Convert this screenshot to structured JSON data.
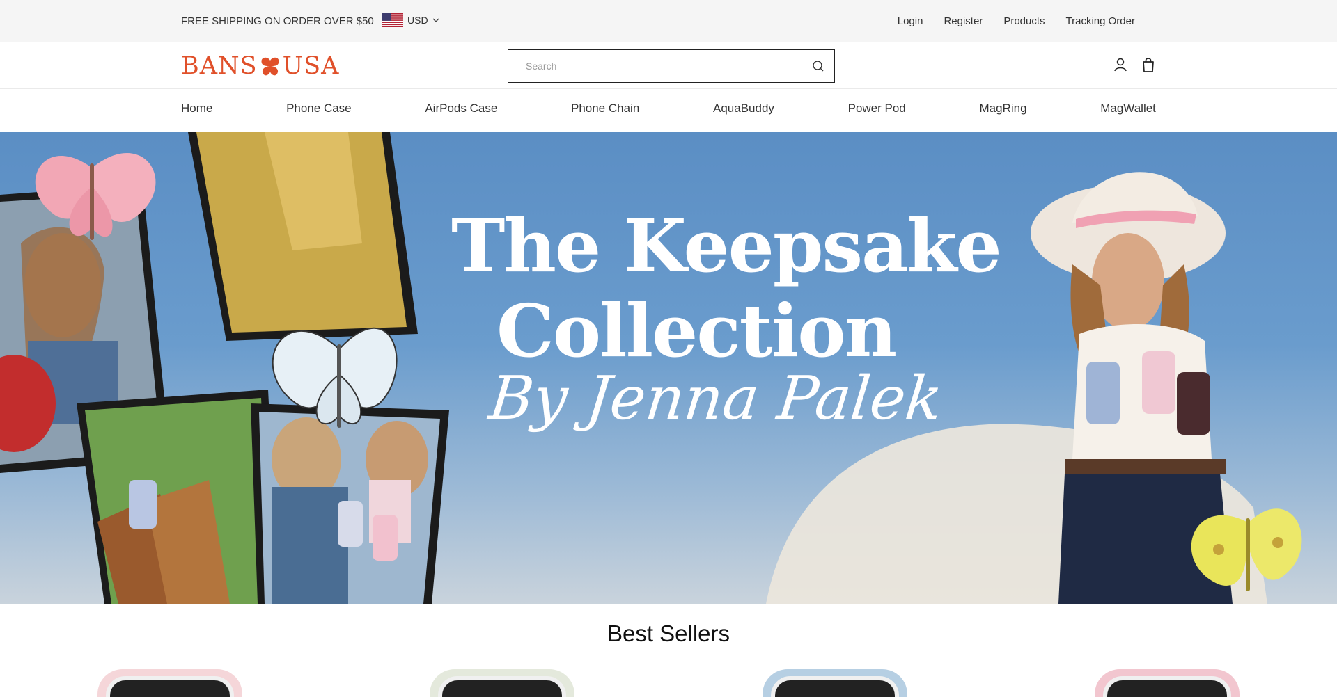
{
  "topbar": {
    "shipping_text": "FREE SHIPPING ON ORDER OVER $50",
    "currency": "USD",
    "links": [
      "Login",
      "Register",
      "Products",
      "Tracking Order"
    ]
  },
  "header": {
    "logo_left": "BANS",
    "logo_right": "USA",
    "search_placeholder": "Search",
    "icons": [
      "user-icon",
      "bag-icon"
    ]
  },
  "nav": {
    "items": [
      "Home",
      "Phone Case",
      "AirPods Case",
      "Phone Chain",
      "AquaBuddy",
      "Power Pod",
      "MagRing",
      "MagWallet"
    ]
  },
  "hero": {
    "line1": "The Keepsake",
    "line2": "Collection",
    "line3": "By Jenna Palek"
  },
  "best_sellers": {
    "title": "Best Sellers"
  },
  "colors": {
    "brand": "#e0502a",
    "topbar_bg": "#f5f5f5",
    "sky": "#5b8ec4"
  }
}
